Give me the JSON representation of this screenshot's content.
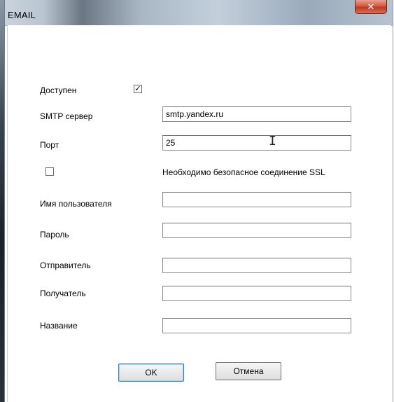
{
  "window": {
    "title": "EMAIL",
    "close_glyph": "✕"
  },
  "form": {
    "enabled": {
      "label": "Доступен",
      "checked": true
    },
    "smtp": {
      "label": "SMTP сервер",
      "value": "smtp.yandex.ru"
    },
    "port": {
      "label": "Порт",
      "value": "25"
    },
    "ssl": {
      "label": "Необходимо безопасное соединение SSL",
      "checked": false
    },
    "username": {
      "label": "Имя пользователя",
      "value": ""
    },
    "password": {
      "label": "Пароль",
      "value": ""
    },
    "sender": {
      "label": "Отправитель",
      "value": ""
    },
    "recipient": {
      "label": "Получатель",
      "value": ""
    },
    "subject": {
      "label": "Название",
      "value": ""
    }
  },
  "buttons": {
    "ok": "OK",
    "cancel": "Отмена"
  }
}
